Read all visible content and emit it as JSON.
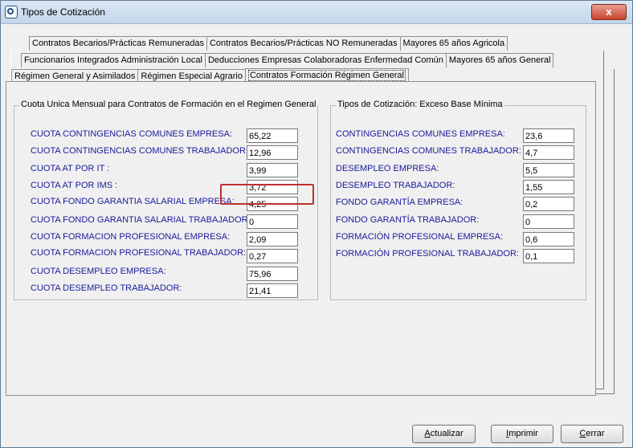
{
  "window": {
    "title": "Tipos de Cotización",
    "close_label": "x"
  },
  "tabs": {
    "row1": [
      "Contratos Becarios/Prácticas Remuneradas",
      "Contratos Becarios/Prácticas NO Remuneradas",
      "Mayores 65 años Agricola"
    ],
    "row2": [
      "Funcionarios Integrados Administración Local",
      "Deducciones Empresas Colaboradoras Enfermedad Común",
      "Mayores 65 años General"
    ],
    "row3": [
      "Régimen General y Asimilados",
      "Régimen Especial Agrario",
      "Contratos Formación Régimen General"
    ],
    "active": "Contratos Formación Régimen General"
  },
  "left_group": {
    "legend": "Cuota Unica Mensual para Contratos de Formación en el Regimen General",
    "fields": [
      {
        "label": "CUOTA CONTINGENCIAS COMUNES EMPRESA:",
        "value": "65,22"
      },
      {
        "label": "CUOTA CONTINGENCIAS COMUNES TRABAJADOR:",
        "value": "12,96"
      },
      {
        "label": "CUOTA AT POR  IT :",
        "value": "3,99"
      },
      {
        "label": "CUOTA AT POR IMS :",
        "value": "3,72"
      },
      {
        "label": "CUOTA FONDO GARANTIA SALARIAL EMPRESA:",
        "value": "4,25"
      },
      {
        "label": "CUOTA FONDO GARANTIA SALARIAL TRABAJADOR:",
        "value": "0"
      },
      {
        "label": "CUOTA FORMACION PROFESIONAL EMPRESA:",
        "value": "2,09"
      },
      {
        "label": "CUOTA FORMACION PROFESIONAL TRABAJADOR:",
        "value": "0,27"
      },
      {
        "label": "CUOTA DESEMPLEO EMPRESA:",
        "value": "75,96"
      },
      {
        "label": "CUOTA DESEMPLEO TRABAJADOR:",
        "value": "21,41"
      }
    ]
  },
  "right_group": {
    "legend": "Tipos de Cotización: Exceso Base Mínima",
    "fields": [
      {
        "label": "CONTINGENCIAS COMUNES EMPRESA:",
        "value": "23,6"
      },
      {
        "label": "CONTINGENCIAS COMUNES TRABAJADOR:",
        "value": "4,7"
      },
      {
        "label": "DESEMPLEO EMPRESA:",
        "value": "5,5"
      },
      {
        "label": "DESEMPLEO TRABAJADOR:",
        "value": "1,55"
      },
      {
        "label": "FONDO GARANTÍA EMPRESA:",
        "value": "0,2"
      },
      {
        "label": "FONDO GARANTÍA TRABAJADOR:",
        "value": "0"
      },
      {
        "label": "FORMACIÓN PROFESIONAL EMPRESA:",
        "value": "0,6"
      },
      {
        "label": "FORMACIÓN PROFESIONAL TRABAJADOR:",
        "value": "0,1"
      }
    ]
  },
  "buttons": {
    "actualizar": {
      "underline": "A",
      "rest": "ctualizar"
    },
    "imprimir": {
      "underline": "I",
      "rest": "mprimir"
    },
    "cerrar": {
      "underline": "C",
      "rest": "errar"
    }
  },
  "colors": {
    "label_text": "#1a1a9c",
    "highlight_border": "#c02f2f"
  }
}
